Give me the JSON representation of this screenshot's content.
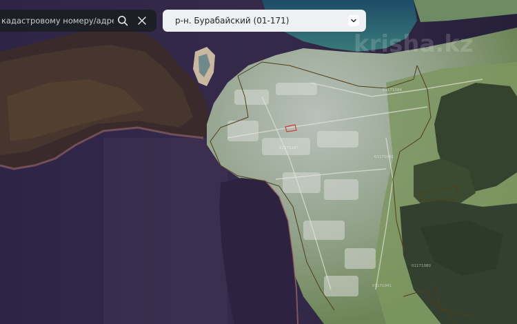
{
  "search": {
    "placeholder": "кадастровому номеру/адресу"
  },
  "district_select": {
    "selected": "р-н. Бурабайский (01-171)"
  },
  "watermark": "krisha.kz",
  "parcel_labels": [
    "01171187",
    "01171084",
    "01171041",
    "01171080",
    "01171041"
  ],
  "colors": {
    "water_deep": "#2c2640",
    "water_lake": "#2a5a70",
    "forest": "#3a4a33",
    "meadow": "#6f8a55",
    "settlement": "#a9b2a8",
    "boundary_line": "#5a4a20",
    "selected_parcel": "#d23a3a"
  },
  "icons": [
    "search-icon",
    "close-icon",
    "chevron-down-icon"
  ]
}
